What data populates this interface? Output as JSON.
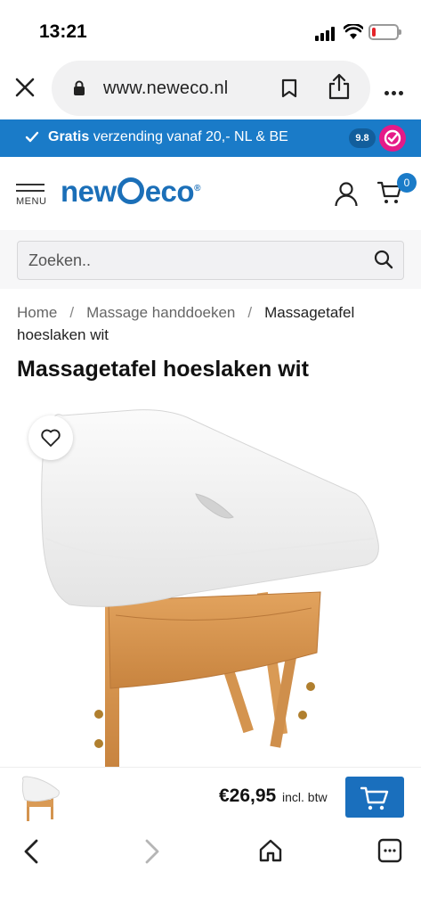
{
  "status_bar": {
    "time": "13:21"
  },
  "browser": {
    "url": "www.neweco.nl"
  },
  "promo": {
    "bold_text": "Gratis",
    "text": " verzending vanaf 20,- NL & BE",
    "rating": "9.8",
    "accent_color": "#1a7bc8"
  },
  "header": {
    "menu_label": "MENU",
    "logo_left": "new",
    "logo_right": "eco",
    "logo_mark": "®",
    "cart_count": "0",
    "brand_color": "#1b6fb8"
  },
  "search": {
    "placeholder": "Zoeken.."
  },
  "breadcrumb": {
    "items": [
      "Home",
      "Massage handdoeken",
      "Massagetafel hoeslaken wit"
    ],
    "separator": "/"
  },
  "product": {
    "title": "Massagetafel hoeslaken wit",
    "price": "€26,95",
    "price_note": "incl. btw"
  },
  "icons": {
    "wishlist": "heart-icon",
    "add_to_cart": "cart-icon",
    "back": "chevron-left-icon",
    "forward": "chevron-right-icon",
    "home": "home-icon",
    "tabs": "tabs-icon"
  }
}
